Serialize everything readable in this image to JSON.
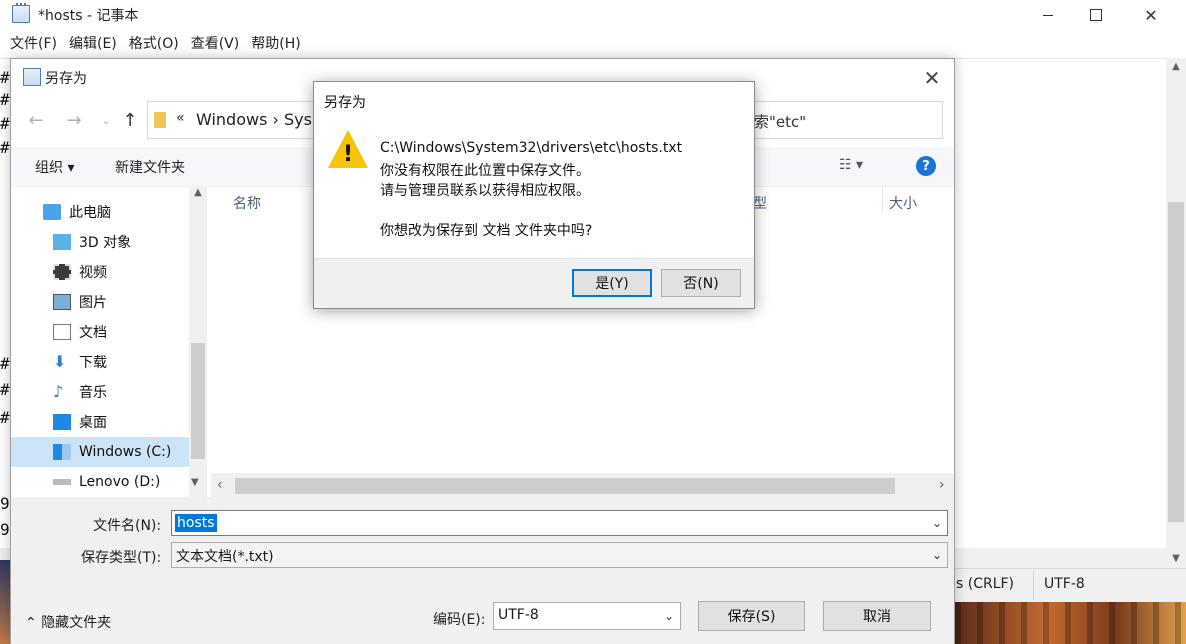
{
  "notepad": {
    "title": "*hosts - 记事本",
    "menu": [
      "文件(F)",
      "编辑(E)",
      "格式(O)",
      "查看(V)",
      "帮助(H)"
    ],
    "status_line_ending": "s (CRLF)",
    "status_encoding": "UTF-8"
  },
  "save_as": {
    "title": "另存为",
    "address_chevron": "«",
    "address_path": "Windows  ›  Sys",
    "search_placeholder": "索\"etc\"",
    "toolbar": {
      "organize": "组织 ▾",
      "new_folder": "新建文件夹",
      "view": "☷ ▾",
      "help": "?"
    },
    "nav_items": [
      {
        "label": "此电脑",
        "icon": "computer-icon"
      },
      {
        "label": "3D 对象",
        "icon": "cube-icon"
      },
      {
        "label": "视频",
        "icon": "film-icon"
      },
      {
        "label": "图片",
        "icon": "picture-icon"
      },
      {
        "label": "文档",
        "icon": "document-icon"
      },
      {
        "label": "下载",
        "icon": "download-icon"
      },
      {
        "label": "音乐",
        "icon": "music-icon"
      },
      {
        "label": "桌面",
        "icon": "desktop-icon"
      },
      {
        "label": "Windows (C:)",
        "icon": "drive-c-icon",
        "selected": true
      },
      {
        "label": "Lenovo (D:)",
        "icon": "drive-d-icon"
      }
    ],
    "columns": {
      "name": "名称",
      "type": "型",
      "size": "大小"
    },
    "filename_label": "文件名(N):",
    "filename_value": "hosts",
    "filetype_label": "保存类型(T):",
    "filetype_value": "文本文档(*.txt)",
    "encoding_label": "编码(E):",
    "encoding_value": "UTF-8",
    "save_button": "保存(S)",
    "cancel_button": "取消",
    "hide_folders": "隐藏文件夹"
  },
  "message_box": {
    "title": "另存为",
    "lines": [
      "C:\\Windows\\System32\\drivers\\etc\\hosts.txt",
      "你没有权限在此位置中保存文件。",
      "请与管理员联系以获得相应权限。",
      "你想改为保存到 文档 文件夹中吗?"
    ],
    "yes_button": "是(Y)",
    "no_button": "否(N)"
  },
  "colors": {
    "accent": "#0078d7",
    "selection": "#cce4f7",
    "warning": "#f6c400"
  }
}
